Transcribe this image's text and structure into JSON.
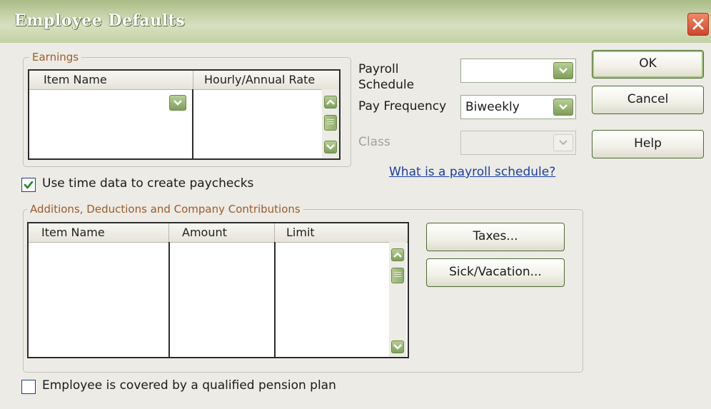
{
  "window": {
    "title": "Employee Defaults"
  },
  "earnings": {
    "label": "Earnings",
    "columns": [
      "Item Name",
      "Hourly/Annual Rate"
    ]
  },
  "payroll": {
    "schedule_label": "Payroll Schedule",
    "schedule_value": "",
    "frequency_label": "Pay Frequency",
    "frequency_value": "Biweekly",
    "class_label": "Class",
    "class_value": "",
    "help_link": "What is a payroll schedule?"
  },
  "buttons": {
    "ok": "OK",
    "cancel": "Cancel",
    "help": "Help",
    "taxes": "Taxes...",
    "sick_vacation": "Sick/Vacation..."
  },
  "time_data": {
    "label": "Use time data to create paychecks",
    "checked": true
  },
  "additions": {
    "label": "Additions, Deductions and Company Contributions",
    "columns": [
      "Item Name",
      "Amount",
      "Limit"
    ]
  },
  "pension": {
    "label": "Employee is covered by a qualified pension plan",
    "checked": false
  },
  "colors": {
    "accent": "#7e9e58",
    "group_label": "#9c5a2c",
    "link": "#1b3ea0"
  },
  "icons": {
    "close": "close-icon",
    "check": "checkmark-icon",
    "dropdown": "chevron-down-icon"
  }
}
